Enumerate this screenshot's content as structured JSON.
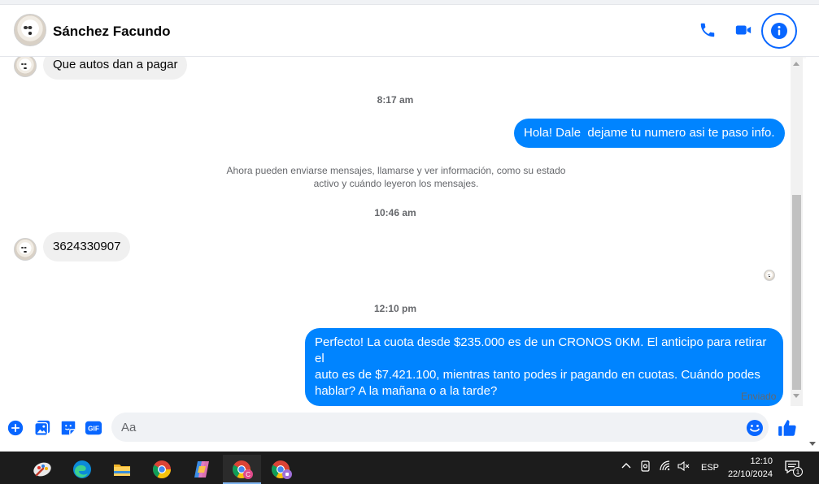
{
  "header": {
    "contact_name": "Sánchez Facundo"
  },
  "messages": {
    "m1_text": "Que autos dan a pagar",
    "time1": "8:17 am",
    "m2_text": "Hola! Dale  dejame tu numero asi te paso info.",
    "notice_line1": "Ahora pueden enviarse mensajes, llamarse y ver información, como su estado",
    "notice_line2": "activo y cuándo leyeron los mensajes.",
    "time2": "10:46 am",
    "m3_text": "3624330907",
    "time3": "12:10 pm",
    "m4_line1": "Perfecto! La cuota desde $235.000 es de un CRONOS 0KM. El anticipo para retirar el",
    "m4_line2": "auto es de $7.421.100, mientras tanto podes ir pagando en cuotas. Cuándo podes",
    "m4_line3": "hablar? A la mañana o a la tarde?",
    "status": "Enviado"
  },
  "composer": {
    "placeholder": "Aa"
  },
  "taskbar": {
    "language": "ESP",
    "time": "12:10",
    "date": "22/10/2024",
    "notification_count": "1",
    "chrome_profile_letter": "C"
  },
  "icons": {
    "call": "phone-icon",
    "video": "video-camera-icon",
    "info": "info-icon",
    "add": "plus-circle-icon",
    "gallery": "image-gallery-icon",
    "sticker": "sticker-icon",
    "gif": "gif-icon",
    "emoji": "smiley-icon",
    "like": "thumbs-up-icon"
  },
  "colors": {
    "accent": "#0866ff",
    "outgoing_bubble": "#0084ff",
    "incoming_bubble": "#f0f0f0",
    "taskbar": "#1c1c1c"
  },
  "gif_label": "GIF"
}
